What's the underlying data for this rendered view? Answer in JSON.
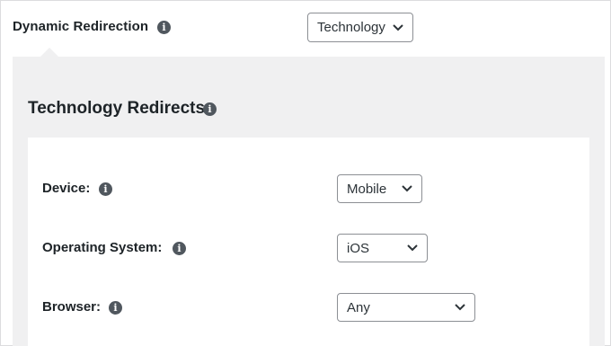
{
  "dynamic_redirection": {
    "label": "Dynamic Redirection",
    "selected": "Technology"
  },
  "section": {
    "title": "Technology Redirects"
  },
  "fields": {
    "device": {
      "label": "Device:",
      "selected": "Mobile"
    },
    "operating_system": {
      "label": "Operating System:",
      "selected": "iOS"
    },
    "browser": {
      "label": "Browser:",
      "selected": "Any"
    }
  },
  "icons": {
    "info": "info-icon",
    "dropdown": "chevron-down-icon"
  },
  "colors": {
    "panel_background": "#f0f0f1",
    "info_icon": "#50575e",
    "select_border": "#8c8f94"
  }
}
